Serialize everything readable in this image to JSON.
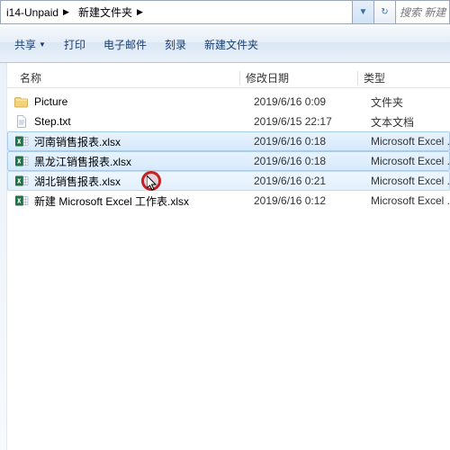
{
  "breadcrumb": {
    "p1": "i14-Unpaid",
    "p2": "新建文件夹"
  },
  "search": {
    "placeholder": "搜索 新建"
  },
  "toolbar": {
    "share": "共享",
    "print": "打印",
    "email": "电子邮件",
    "burn": "刻录",
    "newfolder": "新建文件夹"
  },
  "columns": {
    "name": "名称",
    "date": "修改日期",
    "type": "类型"
  },
  "files": [
    {
      "name": "Picture",
      "date": "2019/6/16 0:09",
      "type": "文件夹",
      "icon": "folder"
    },
    {
      "name": "Step.txt",
      "date": "2019/6/15 22:17",
      "type": "文本文档",
      "icon": "txt"
    },
    {
      "name": "河南销售报表.xlsx",
      "date": "2019/6/16 0:18",
      "type": "Microsoft Excel ...",
      "icon": "xlsx"
    },
    {
      "name": "黑龙江销售报表.xlsx",
      "date": "2019/6/16 0:18",
      "type": "Microsoft Excel ...",
      "icon": "xlsx"
    },
    {
      "name": "湖北销售报表.xlsx",
      "date": "2019/6/16 0:21",
      "type": "Microsoft Excel ...",
      "icon": "xlsx"
    },
    {
      "name": "新建 Microsoft Excel 工作表.xlsx",
      "date": "2019/6/16 0:12",
      "type": "Microsoft Excel ...",
      "icon": "xlsx"
    }
  ],
  "selection": [
    2,
    3,
    4
  ],
  "highlight_last": 4
}
